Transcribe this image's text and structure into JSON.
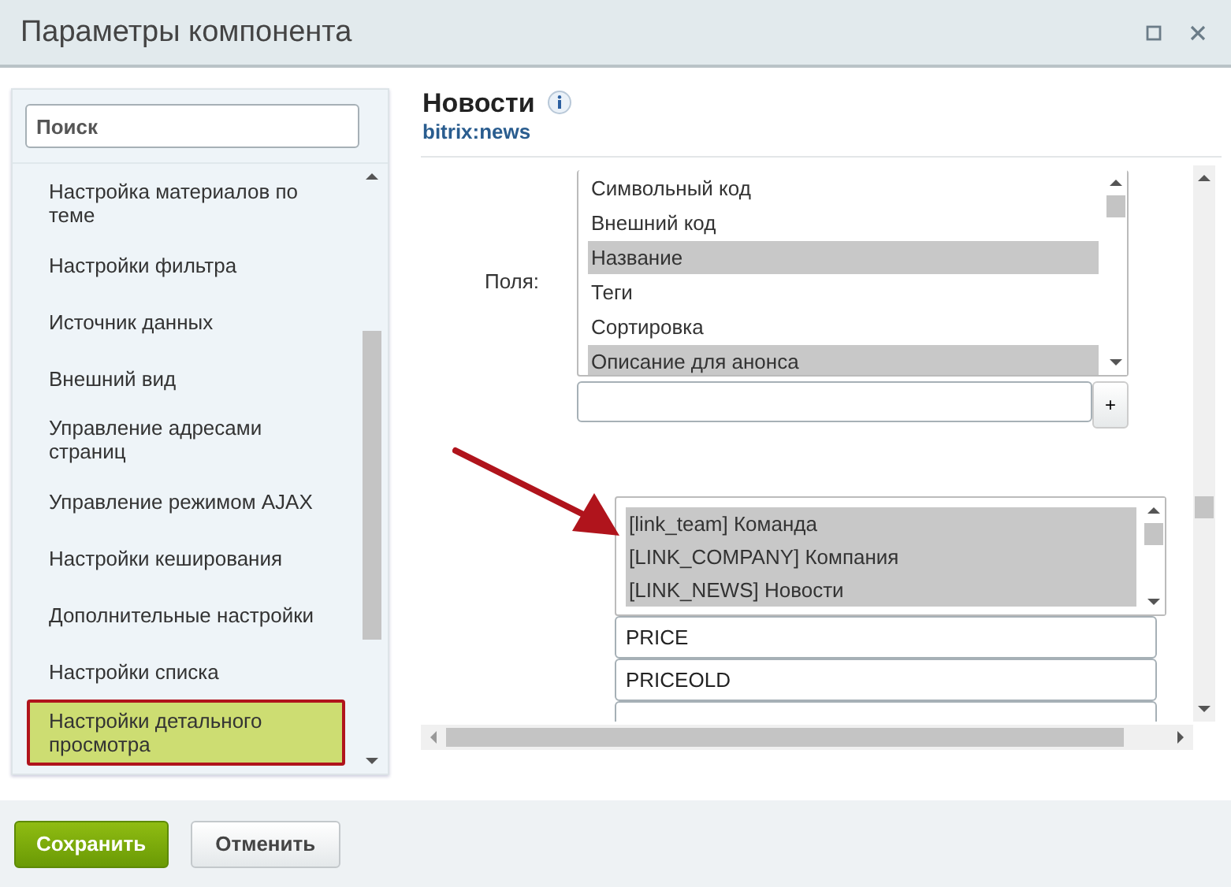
{
  "window": {
    "title": "Параметры компонента"
  },
  "sidebar": {
    "search": {
      "placeholder": "Поиск"
    },
    "items": [
      {
        "label": "Настройка материалов по теме",
        "selected": false
      },
      {
        "label": "Настройки фильтра",
        "selected": false
      },
      {
        "label": "Источник данных",
        "selected": false
      },
      {
        "label": "Внешний вид",
        "selected": false
      },
      {
        "label": "Управление адресами страниц",
        "selected": false
      },
      {
        "label": "Управление режимом AJAX",
        "selected": false
      },
      {
        "label": "Настройки кеширования",
        "selected": false
      },
      {
        "label": "Дополнительные настройки",
        "selected": false
      },
      {
        "label": "Настройки списка",
        "selected": false
      },
      {
        "label": "Настройки детального просмотра",
        "selected": true
      }
    ]
  },
  "component": {
    "title": "Новости",
    "code": "bitrix:news"
  },
  "fields": {
    "label": "Поля:",
    "options": [
      {
        "label": "Символьный код",
        "selected": false
      },
      {
        "label": "Внешний код",
        "selected": false
      },
      {
        "label": "Название",
        "selected": true
      },
      {
        "label": "Теги",
        "selected": false
      },
      {
        "label": "Сортировка",
        "selected": false
      },
      {
        "label": "Описание для анонса",
        "selected": true
      }
    ],
    "add_button": "+"
  },
  "properties": {
    "options": [
      {
        "label": "[link_team] Команда",
        "selected": true
      },
      {
        "label": "[LINK_COMPANY] Компания",
        "selected": true
      },
      {
        "label": "[LINK_NEWS] Новости",
        "selected": true
      }
    ],
    "inputs": [
      {
        "value": "PRICE"
      },
      {
        "value": "PRICEOLD"
      }
    ]
  },
  "buttons": [
    {
      "label": "Сохранить",
      "kind": "primary"
    },
    {
      "label": "Отменить",
      "kind": "secondary"
    }
  ]
}
